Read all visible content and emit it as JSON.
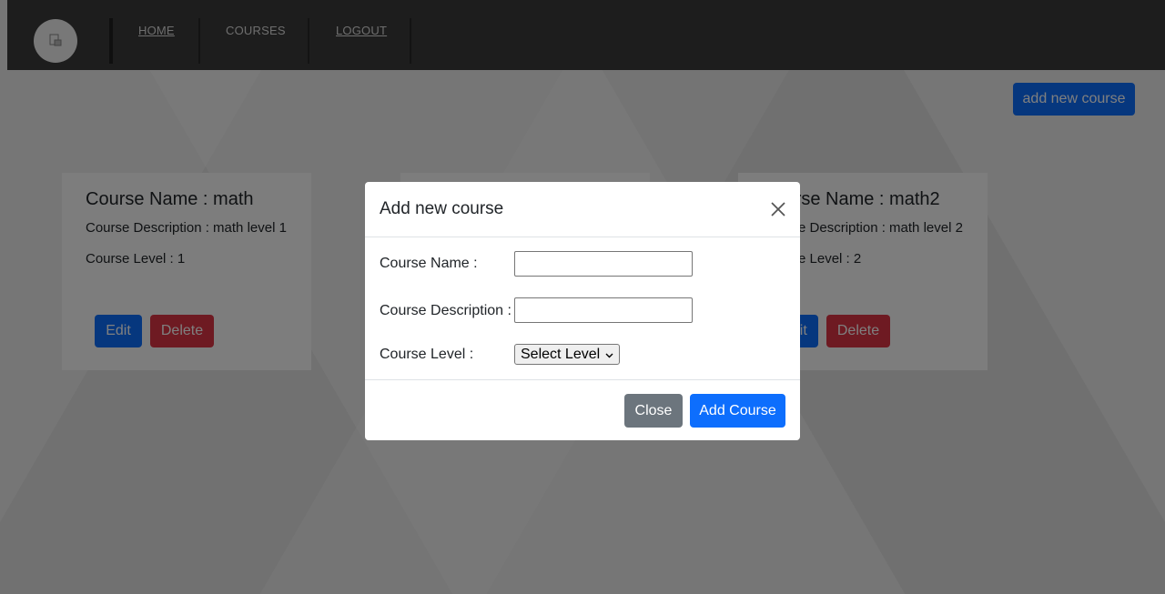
{
  "nav": {
    "logo_icon": "image-placeholder-icon",
    "links": [
      "HOME",
      "COURSES",
      "LOGOUT"
    ]
  },
  "actions": {
    "add_new_course": "add new course"
  },
  "courses": [
    {
      "name": "Course Name : math",
      "description": "Course Description : math level 1",
      "level": "Course Level : 1",
      "edit": "Edit",
      "delete": "Delete"
    },
    {
      "name": "",
      "description": "",
      "level": "",
      "edit": "",
      "delete": ""
    },
    {
      "name": "Course Name : math2",
      "description": "Course Description : math level 2",
      "level": "Course Level : 2",
      "edit": "Edit",
      "delete": "Delete"
    }
  ],
  "modal": {
    "title": "Add new course",
    "fields": {
      "name_label": "Course Name :",
      "name_value": "",
      "description_label": "Course Description :",
      "description_value": "",
      "level_label": "Course Level :",
      "level_selected": "Select Level"
    },
    "close": "Close",
    "submit": "Add Course"
  },
  "colors": {
    "primary": "#0d6efd",
    "danger": "#dc3545",
    "secondary": "#6c757d",
    "navbar": "#3a3a3a"
  }
}
